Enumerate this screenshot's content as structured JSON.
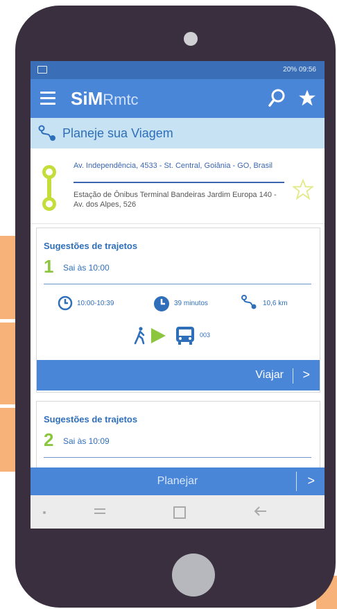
{
  "status_bar": {
    "right": "20% 09:56"
  },
  "app": {
    "brand": "SiM",
    "suffix": "Rmtc"
  },
  "plan_header": {
    "title": "Planeje sua Viagem"
  },
  "route": {
    "origin": "Av. Independência, 4533 - St. Central, Goiânia - GO, Brasil",
    "destination": "Estação de Ônibus Terminal Bandeiras Jardim Europa 140 - Av. dos Alpes, 526"
  },
  "suggestions": [
    {
      "heading": "Sugestões de trajetos",
      "number": "1",
      "depart": "Sai às 10:00",
      "time_range": "10:00-10:39",
      "duration": "39 minutos",
      "distance": "10,6 km",
      "bus_line": "003",
      "action": "Viajar",
      "action_arrow": ">"
    },
    {
      "heading": "Sugestões de trajetos",
      "number": "2",
      "depart": "Sai às 10:09"
    }
  ],
  "plan_button": {
    "label": "Planejar",
    "arrow": ">"
  },
  "colors": {
    "primary": "#4a86d8",
    "accent_green": "#8cc63f",
    "header_bg": "#c6e2f3",
    "phone_body": "#3a2f3f",
    "orange": "#f7b27a"
  },
  "icons": [
    "menu-icon",
    "search-icon",
    "star-icon",
    "route-icon",
    "clock-outline-icon",
    "clock-filled-icon",
    "walk-icon",
    "play-arrow-icon",
    "bus-icon"
  ]
}
